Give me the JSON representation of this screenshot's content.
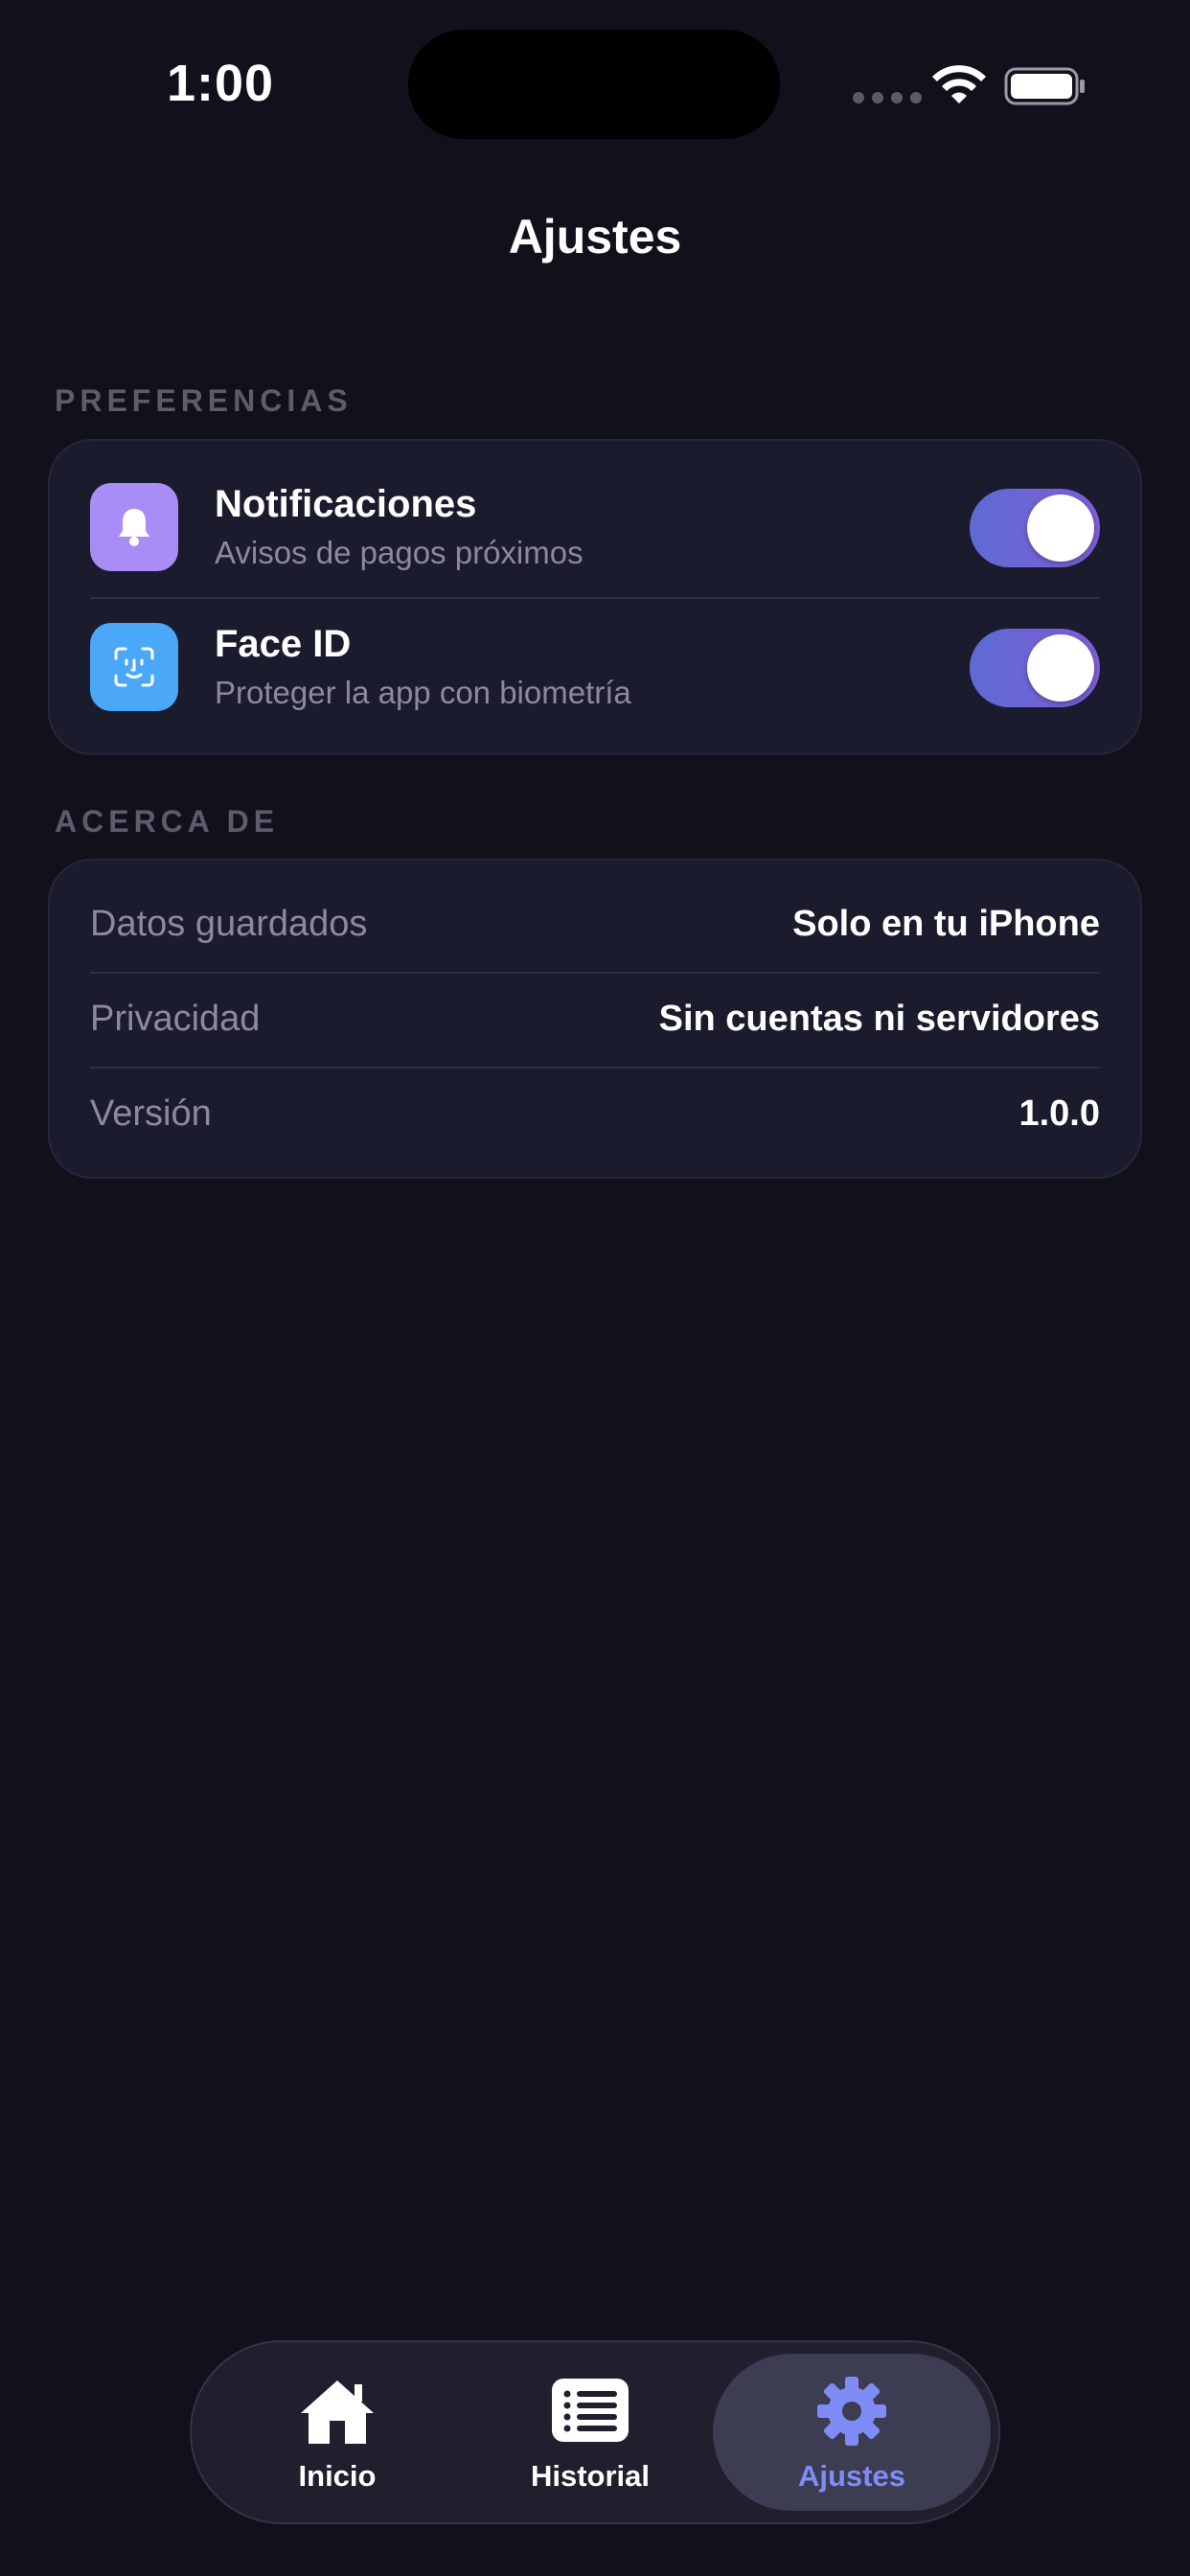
{
  "status_bar": {
    "time": "1:00"
  },
  "header": {
    "title": "Ajustes"
  },
  "preferences": {
    "section_title": "PREFERENCIAS",
    "items": [
      {
        "title": "Notificaciones",
        "subtitle": "Avisos de pagos próximos",
        "icon": "bell-icon",
        "icon_color": "#a98cf6",
        "enabled": true
      },
      {
        "title": "Face ID",
        "subtitle": "Proteger la app con biometría",
        "icon": "face-id-icon",
        "icon_color": "#4ba8f8",
        "enabled": true
      }
    ]
  },
  "about": {
    "section_title": "ACERCA DE",
    "rows": [
      {
        "label": "Datos guardados",
        "value": "Solo en tu iPhone"
      },
      {
        "label": "Privacidad",
        "value": "Sin cuentas ni servidores"
      },
      {
        "label": "Versión",
        "value": "1.0.0"
      }
    ]
  },
  "tab_bar": {
    "tabs": [
      {
        "label": "Inicio",
        "icon": "home-icon",
        "active": false
      },
      {
        "label": "Historial",
        "icon": "list-icon",
        "active": false
      },
      {
        "label": "Ajustes",
        "icon": "gear-icon",
        "active": true
      }
    ]
  },
  "colors": {
    "background": "#11111b",
    "card": "#1b1b2e",
    "accent": "#7f8cf5",
    "toggle_start": "#5e6bd4",
    "toggle_end": "#7e5ed6"
  }
}
